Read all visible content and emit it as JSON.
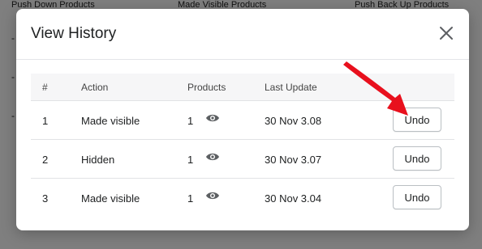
{
  "background_page": {
    "columns": [
      "Push Down Products",
      "Made Visible Products",
      "Push Back Up Products"
    ],
    "row_marks": [
      "-",
      "-",
      "-"
    ]
  },
  "modal": {
    "title": "View History",
    "close_icon": "close-icon",
    "table": {
      "headers": {
        "num": "#",
        "action": "Action",
        "products": "Products",
        "last_update": "Last Update"
      },
      "rows": [
        {
          "num": "1",
          "action": "Made visible",
          "products": "1",
          "last_update": "30 Nov 3.08",
          "button": "Undo"
        },
        {
          "num": "2",
          "action": "Hidden",
          "products": "1",
          "last_update": "30 Nov 3.07",
          "button": "Undo"
        },
        {
          "num": "3",
          "action": "Made visible",
          "products": "1",
          "last_update": "30 Nov 3.04",
          "button": "Undo"
        }
      ]
    }
  },
  "annotation": {
    "icon": "red-arrow-icon",
    "color": "#e8101d"
  },
  "colors": {
    "overlay": "#808080",
    "border": "#e1e3e5",
    "header_bg": "#f6f6f7"
  }
}
